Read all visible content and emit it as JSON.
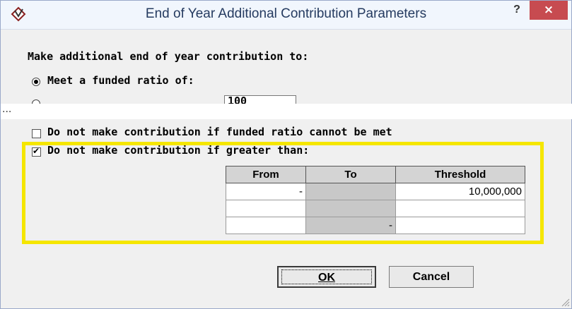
{
  "window": {
    "title": "End of Year Additional Contribution Parameters",
    "help_label": "?",
    "close_label": "×",
    "app_icon": "diamond-arrow-icon"
  },
  "form": {
    "heading": "Make additional end of year contribution to:",
    "radio_funded_ratio_label": "Meet a funded ratio of:",
    "radio_funded_ratio_selected": true,
    "partial_input_value": "100",
    "torn_marker": "...",
    "checkbox_funded_label": "Do not make contribution if funded ratio cannot be met",
    "checkbox_funded_checked": false,
    "checkbox_greater_label": "Do not make contribution if greater than:",
    "checkbox_greater_checked": true
  },
  "table": {
    "headers": [
      "From",
      "To",
      "Threshold"
    ],
    "rows": [
      {
        "from": "-",
        "to": "",
        "threshold": "10,000,000"
      },
      {
        "from": "",
        "to": "",
        "threshold": ""
      },
      {
        "from": "",
        "to": "-",
        "threshold": ""
      }
    ]
  },
  "buttons": {
    "ok_label": "OK",
    "cancel_label": "Cancel"
  },
  "colors": {
    "highlight": "#f5e600",
    "close_button": "#c74b50",
    "title_text": "#253b60"
  }
}
